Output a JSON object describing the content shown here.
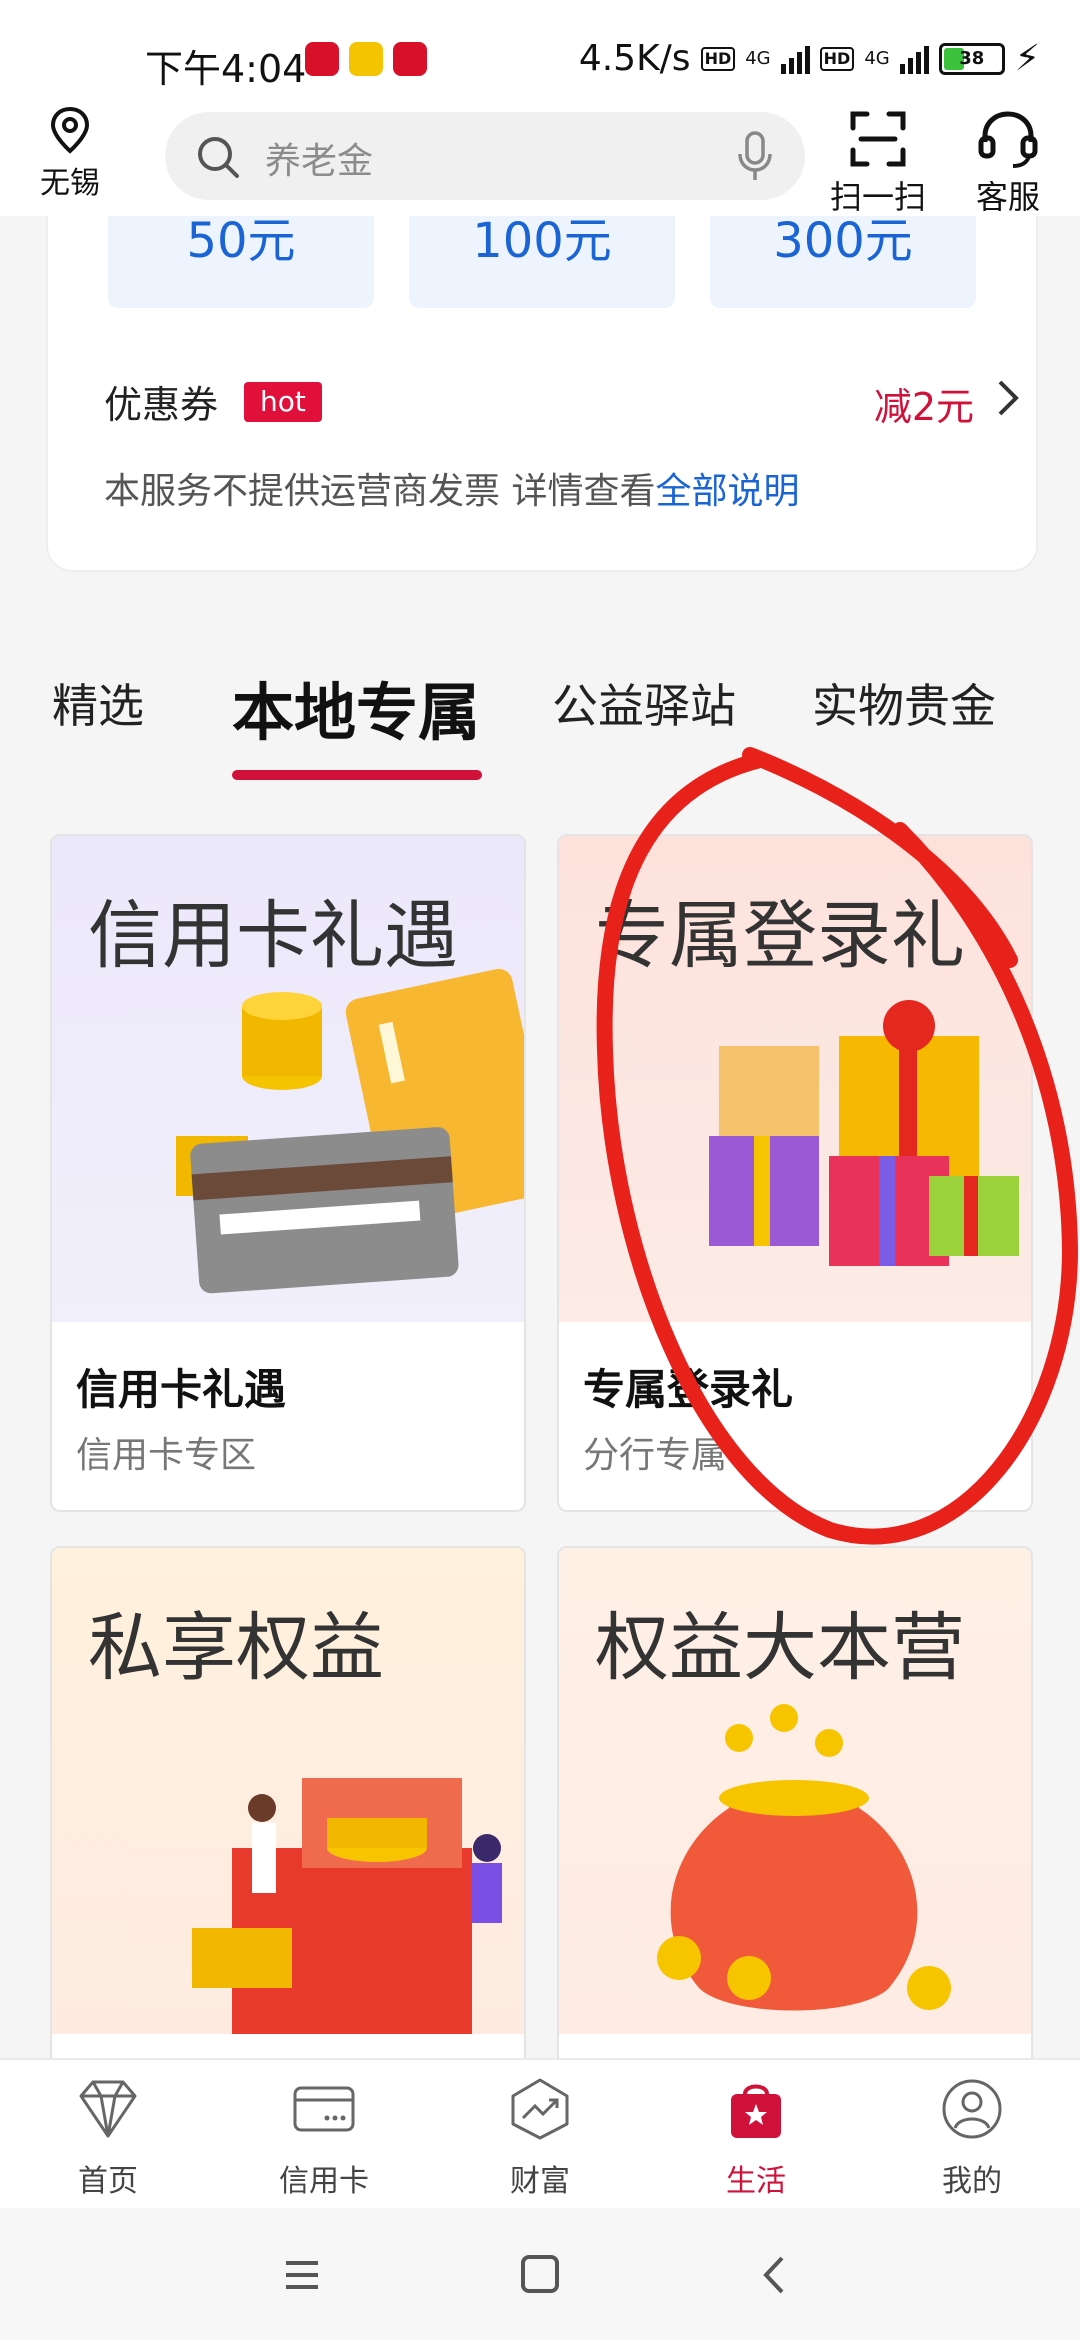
{
  "status": {
    "time": "下午4:04",
    "network_speed": "4.5K/s",
    "hd1": "HD",
    "net1": "4G",
    "hd2": "HD",
    "net2": "4G",
    "battery": "38"
  },
  "header": {
    "location": "无锡",
    "search_placeholder": "养老金",
    "scan_label": "扫一扫",
    "service_label": "客服"
  },
  "top_card": {
    "amounts": [
      "50元",
      "100元",
      "300元"
    ],
    "coupon_label": "优惠券",
    "hot_badge": "hot",
    "coupon_value": "减2元",
    "notice_text": "本服务不提供运营商发票 详情查看",
    "notice_link": "全部说明"
  },
  "tabs": [
    {
      "label": "精选"
    },
    {
      "label": "本地专属"
    },
    {
      "label": "公益驿站"
    },
    {
      "label": "实物贵金"
    }
  ],
  "cards": [
    {
      "art_title": "信用卡礼遇",
      "name": "信用卡礼遇",
      "subtitle": "信用卡专区"
    },
    {
      "art_title": "专属登录礼",
      "name": "专属登录礼",
      "subtitle": "分行专属"
    },
    {
      "art_title": "私享权益"
    },
    {
      "art_title": "权益大本营"
    }
  ],
  "bottom_nav": [
    {
      "label": "首页",
      "icon": "diamond-icon"
    },
    {
      "label": "信用卡",
      "icon": "credit-card-icon"
    },
    {
      "label": "财富",
      "icon": "wealth-chart-icon"
    },
    {
      "label": "生活",
      "icon": "shopping-bag-icon",
      "active": true
    },
    {
      "label": "我的",
      "icon": "user-profile-icon"
    }
  ],
  "colors": {
    "accent_red": "#d0113a",
    "link_blue": "#1a64d6",
    "annotation_red": "#e8211a"
  }
}
